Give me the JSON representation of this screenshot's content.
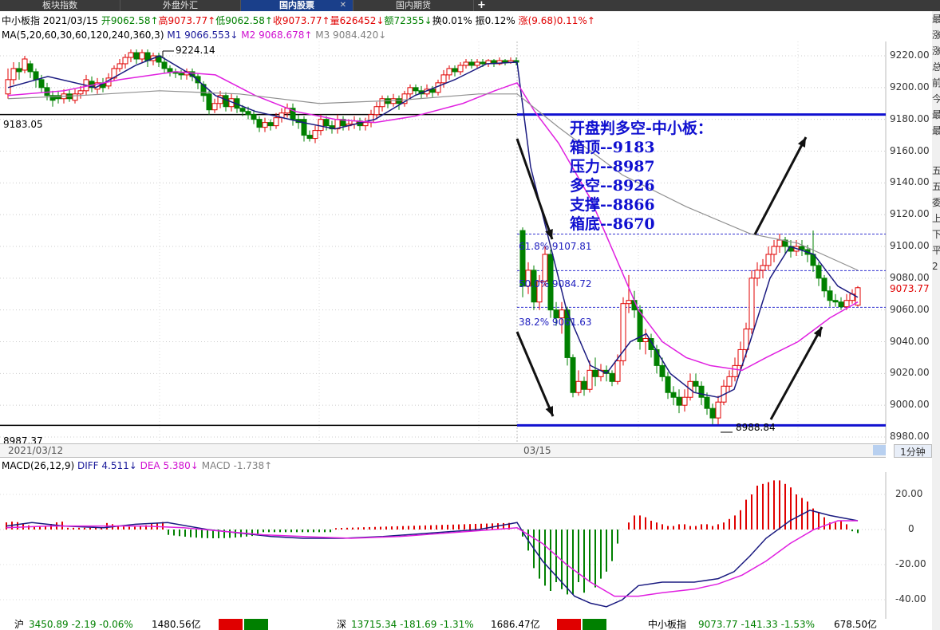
{
  "tabs": [
    {
      "label": "板块指数",
      "active": false
    },
    {
      "label": "外盘外汇",
      "active": false
    },
    {
      "label": "国内股票",
      "active": true
    },
    {
      "label": "国内期货",
      "active": false
    }
  ],
  "new_tab_symbol": "+",
  "header": {
    "name": "中小板指",
    "date": "2021/03/15",
    "open": "开9062.58↑",
    "high": "高9073.77↑",
    "low": "低9062.58↑",
    "close": "收9073.77↑",
    "volume": "量626452↓",
    "amount": "额72355↓",
    "turnover": "换0.01%",
    "amplitude": "振0.12%",
    "change": "涨(9.68)0.11%↑"
  },
  "ma": {
    "label": "MA(5,20,60,30,60,120,240,360,3)",
    "m1": "M1 9066.553↓",
    "m2": "M2 9068.678↑",
    "m3": "M3 9084.420↓"
  },
  "annotation": {
    "title": "开盘判多空-中小板：",
    "lines": [
      "箱顶--9183",
      "压力--8987",
      "多空--8926",
      "支撑--8866",
      "箱底--8670"
    ]
  },
  "price_labels": {
    "high_mark": "9224.14",
    "low_mark": "8988.84",
    "left_line_top": "9183.05",
    "left_line_bottom": "8987.37",
    "current": "9073.77",
    "fib_618": "61.8% 9107.81",
    "fib_50": "50.0% 9084.72",
    "fib_382": "38.2% 9061.63"
  },
  "y_ticks": [
    "9220.00",
    "9200.00",
    "9180.00",
    "9160.00",
    "9140.00",
    "9120.00",
    "9100.00",
    "9080.00",
    "9060.00",
    "9040.00",
    "9020.00",
    "9000.00",
    "8980.00"
  ],
  "date_bar": {
    "left": "2021/03/12",
    "mid": "03/15",
    "period": "1分钟"
  },
  "macd": {
    "label": "MACD(26,12,9)",
    "diff": "DIFF 4.511↓",
    "dea": "DEA 5.380↓",
    "macd": "MACD -1.738↑",
    "y_ticks": [
      "20.00",
      "0",
      "-20.00",
      "-40.00"
    ]
  },
  "bottom_bar": {
    "sh_name": "沪",
    "sh_values": "3450.89 -2.19 -0.06%",
    "sh_amount": "1480.56亿",
    "sz_name": "深",
    "sz_values": "13715.34 -181.69 -1.31%",
    "sz_amount": "1686.47亿",
    "zxb_name": "中小板指",
    "zxb_values": "9073.77 -141.33 -1.53%",
    "zxb_amount": "678.50亿"
  },
  "right_panel": {
    "chars": [
      "最",
      "涨",
      "涨",
      "总",
      "前",
      "今",
      "最",
      "最",
      "五",
      "五",
      "委",
      "上",
      "下",
      "平",
      "2"
    ]
  },
  "colors": {
    "up": "#e00000",
    "down": "#008000",
    "m1": "#1a1a80",
    "m2": "#e020e0",
    "m3": "#909090",
    "guide": "#1010d0"
  },
  "chart_data": {
    "type": "candlestick",
    "title": "中小板指",
    "y_range": [
      8980,
      9230
    ],
    "levels": {
      "box_top": 9183.05,
      "box_bottom": 8987.37,
      "fib_618": 9107.81,
      "fib_50": 9084.72,
      "fib_382": 9061.63
    },
    "macd_range": [
      -45,
      35
    ]
  }
}
